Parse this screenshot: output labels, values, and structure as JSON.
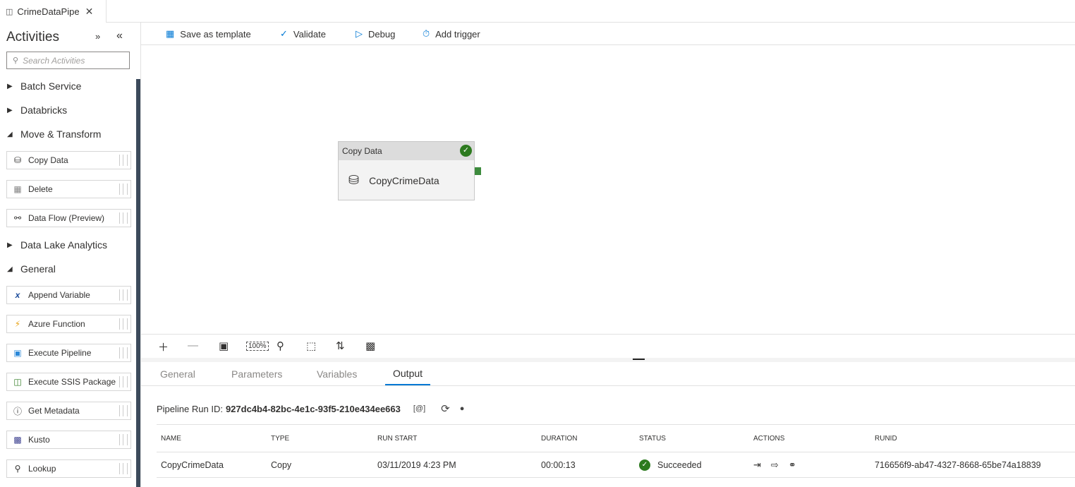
{
  "tab": {
    "title": "CrimeDataPipe",
    "icon": "pipeline-icon"
  },
  "sidebar": {
    "title": "Activities",
    "search_placeholder": "Search Activities",
    "groups": [
      {
        "label": "Batch Service",
        "expanded": false
      },
      {
        "label": "Databricks",
        "expanded": false
      },
      {
        "label": "Move & Transform",
        "expanded": true
      },
      {
        "label": "Data Lake Analytics",
        "expanded": false
      },
      {
        "label": "General",
        "expanded": true
      }
    ],
    "items": [
      {
        "label": "Copy Data",
        "icon": "database-icon"
      },
      {
        "label": "Delete",
        "icon": "trash-icon"
      },
      {
        "label": "Data Flow (Preview)",
        "icon": "dataflow-icon"
      },
      {
        "label": "Append Variable",
        "icon": "variable-icon"
      },
      {
        "label": "Azure Function",
        "icon": "function-icon"
      },
      {
        "label": "Execute Pipeline",
        "icon": "execute-pipeline-icon"
      },
      {
        "label": "Execute SSIS Package",
        "icon": "ssis-icon"
      },
      {
        "label": "Get Metadata",
        "icon": "info-icon"
      },
      {
        "label": "Kusto",
        "icon": "kusto-icon"
      },
      {
        "label": "Lookup",
        "icon": "lookup-icon"
      }
    ]
  },
  "toolbar": {
    "save_template": "Save as template",
    "validate": "Validate",
    "debug": "Debug",
    "add_trigger": "Add trigger"
  },
  "canvas": {
    "node": {
      "type_label": "Copy Data",
      "name": "CopyCrimeData",
      "status": "succeeded"
    }
  },
  "bottom": {
    "tabs": [
      "General",
      "Parameters",
      "Variables",
      "Output"
    ],
    "active_tab": "Output",
    "run_id_label": "Pipeline Run ID:",
    "run_id": "927dc4b4-82bc-4e1c-93f5-210e434ee663",
    "columns": [
      "NAME",
      "TYPE",
      "RUN START",
      "DURATION",
      "STATUS",
      "ACTIONS",
      "RUNID"
    ],
    "rows": [
      {
        "name": "CopyCrimeData",
        "type": "Copy",
        "run_start": "03/11/2019 4:23 PM",
        "duration": "00:00:13",
        "status": "Succeeded",
        "runid": "716656f9-ab47-4327-8668-65be74a18839"
      }
    ]
  },
  "colors": {
    "accent": "#0078d4",
    "success": "#2d7a1f",
    "sidebar_scroll": "#3c4a5b"
  }
}
